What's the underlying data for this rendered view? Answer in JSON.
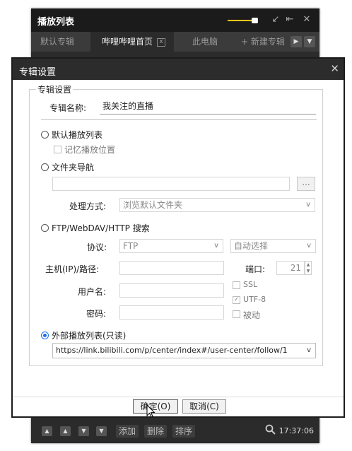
{
  "playlist": {
    "title": "播放列表",
    "tabs": [
      {
        "label": "默认专辑"
      },
      {
        "label": "哔哩哔哩首页"
      },
      {
        "label": "此电脑"
      },
      {
        "label": "+ 新建专辑"
      }
    ],
    "bottom": {
      "add_label": "添加",
      "delete_label": "删除",
      "sort_label": "排序",
      "time": "17:37:06"
    }
  },
  "dialog": {
    "title": "专辑设置",
    "group_label": "专辑设置",
    "album_name_label": "专辑名称:",
    "album_name_value": "我关注的直播",
    "default_playlist_label": "默认播放列表",
    "remember_position_label": "记忆播放位置",
    "folder_nav_label": "文件夹导航",
    "browse_button_label": "...",
    "process_label": "处理方式:",
    "process_value": "浏览默认文件夹",
    "ftp_label": "FTP/WebDAV/HTTP 搜索",
    "protocol_label": "协议:",
    "protocol_value": "FTP",
    "auto_select_value": "自动选择",
    "host_label": "主机(IP)/路径:",
    "port_label": "端口:",
    "port_value": "21",
    "ssl_label": "SSL",
    "user_label": "用户名:",
    "utf8_label": "UTF-8",
    "password_label": "密码:",
    "passive_label": "被动",
    "external_label": "外部播放列表(只读)",
    "external_url": "https://link.bilibili.com/p/center/index#/user-center/follow/1",
    "ok_label": "确定(O)",
    "cancel_label": "取消(C)"
  },
  "colors": {
    "accent": "#1a73e8",
    "volume": "#f2c318",
    "dark_chrome": "#2b2b2b"
  }
}
